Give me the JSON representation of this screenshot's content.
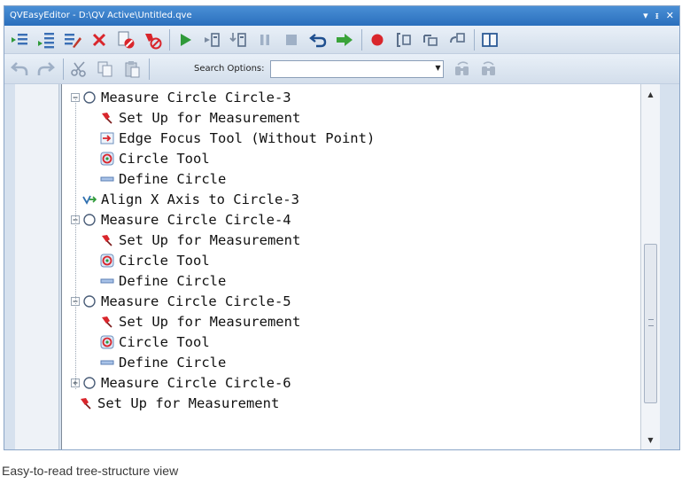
{
  "window": {
    "title": "QVEasyEditor - D:\\QV Active\\Untitled.qve"
  },
  "title_controls": {
    "menu": "▾",
    "pin": "ᵻ",
    "close": "✕"
  },
  "search": {
    "label": "Search Options:",
    "value": ""
  },
  "tree": [
    {
      "label": "Measure Circle Circle-3",
      "icon": "circle-outline-icon",
      "expander": "minus"
    },
    {
      "label": "Set Up for Measurement",
      "icon": "red-pin-icon"
    },
    {
      "label": "Edge Focus Tool (Without Point)",
      "icon": "edge-focus-icon"
    },
    {
      "label": "Circle Tool",
      "icon": "circle-tool-icon"
    },
    {
      "label": "Define Circle",
      "icon": "define-bar-icon"
    },
    {
      "label": "Align X Axis to Circle-3",
      "icon": "align-axis-icon"
    },
    {
      "label": "Measure Circle Circle-4",
      "icon": "circle-outline-icon",
      "expander": "minus"
    },
    {
      "label": "Set Up for Measurement",
      "icon": "red-pin-icon"
    },
    {
      "label": "Circle Tool",
      "icon": "circle-tool-icon"
    },
    {
      "label": "Define Circle",
      "icon": "define-bar-icon"
    },
    {
      "label": "Measure Circle Circle-5",
      "icon": "circle-outline-icon",
      "expander": "minus"
    },
    {
      "label": "Set Up for Measurement",
      "icon": "red-pin-icon"
    },
    {
      "label": "Circle Tool",
      "icon": "circle-tool-icon"
    },
    {
      "label": "Define Circle",
      "icon": "define-bar-icon"
    },
    {
      "label": "Measure Circle Circle-6",
      "icon": "circle-outline-icon",
      "expander": "plus"
    },
    {
      "label": "Set Up for Measurement",
      "icon": "red-pin-icon"
    }
  ],
  "caption": "Easy-to-read tree-structure view",
  "colors": {
    "titlebar": "#3c82cf",
    "accent_red": "#d9262c",
    "accent_green": "#3aa33a"
  }
}
